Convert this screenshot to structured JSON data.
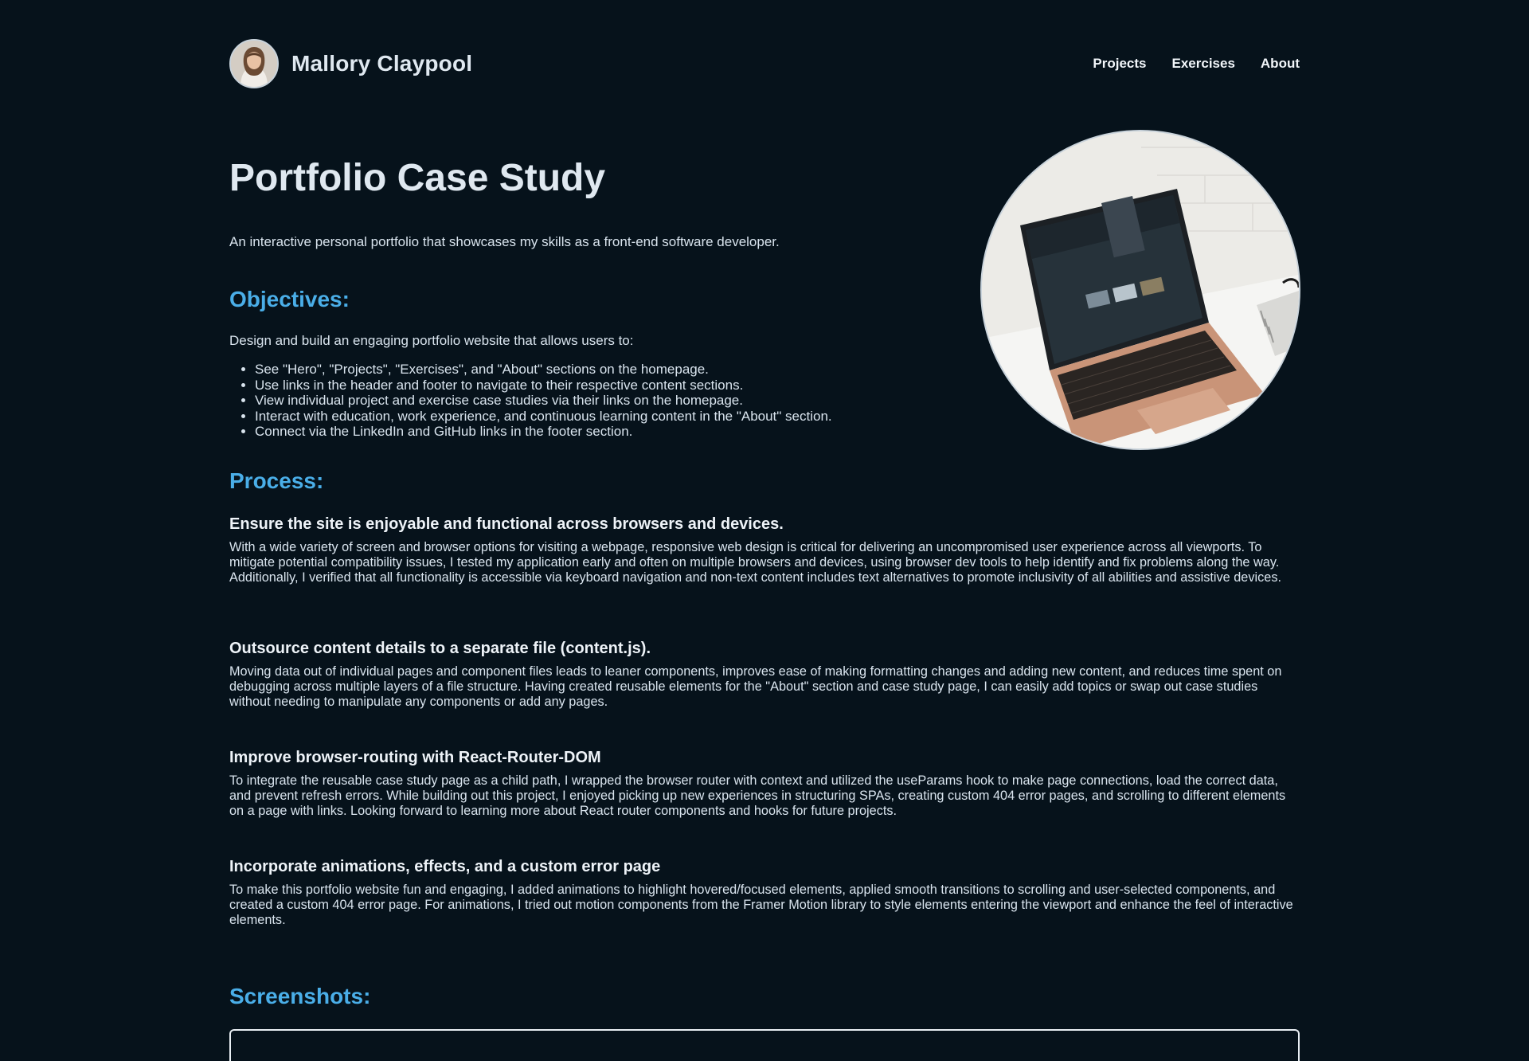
{
  "header": {
    "name": "Mallory Claypool",
    "nav": [
      "Projects",
      "Exercises",
      "About"
    ]
  },
  "hero": {
    "title": "Portfolio Case Study",
    "intro": "An interactive personal portfolio that showcases my skills as a front-end software developer."
  },
  "objectives": {
    "heading": "Objectives:",
    "lead": "Design and build an engaging portfolio website that allows users to:",
    "items": [
      "See \"Hero\", \"Projects\", \"Exercises\", and \"About\" sections on the homepage.",
      "Use links in the header and footer to navigate to their respective content sections.",
      "View individual project and exercise case studies via their links on the homepage.",
      "Interact with education, work experience, and continuous learning content in the \"About\" section.",
      "Connect via the LinkedIn and GitHub links in the footer section."
    ]
  },
  "process": {
    "heading": "Process:",
    "items": [
      {
        "title": "Ensure the site is enjoyable and functional across browsers and devices.",
        "body": "With a wide variety of screen and browser options for visiting a webpage, responsive web design is critical for delivering an uncompromised user experience across all viewports. To mitigate potential compatibility issues, I tested my application early and often on multiple browsers and devices, using browser dev tools to help identify and fix problems along the way. Additionally, I verified that all functionality is accessible via keyboard navigation and non-text content includes text alternatives to promote inclusivity of all abilities and assistive devices."
      },
      {
        "title": "Outsource content details to a separate file (content.js).",
        "body": "Moving data out of individual pages and component files leads to leaner components, improves ease of making formatting changes and adding new content, and reduces time spent on debugging across multiple layers of a file structure. Having created reusable elements for the \"About\" section and case study page, I can easily add topics or swap out case studies without needing to manipulate any components or add any pages."
      },
      {
        "title": "Improve browser-routing with React-Router-DOM",
        "body": "To integrate the reusable case study page as a child path, I wrapped the browser router with context and utilized the useParams hook to make page connections, load the correct data, and prevent refresh errors. While building out this project, I enjoyed picking up new experiences in structuring SPAs, creating custom 404 error pages, and scrolling to different elements on a page with links. Looking forward to learning more about React router components and hooks for future projects."
      },
      {
        "title": "Incorporate animations, effects, and a custom error page",
        "body": "To make this portfolio website fun and engaging, I added animations to highlight hovered/focused elements, applied smooth transitions to scrolling and user-selected components, and created a custom 404 error page. For animations, I tried out motion components from the Framer Motion library to style elements entering the viewport and enhance the feel of interactive elements."
      }
    ]
  },
  "screenshots": {
    "heading": "Screenshots:"
  },
  "colors": {
    "background": "#06121b",
    "accent": "#4aaee8",
    "text": "#d9e4ee"
  }
}
